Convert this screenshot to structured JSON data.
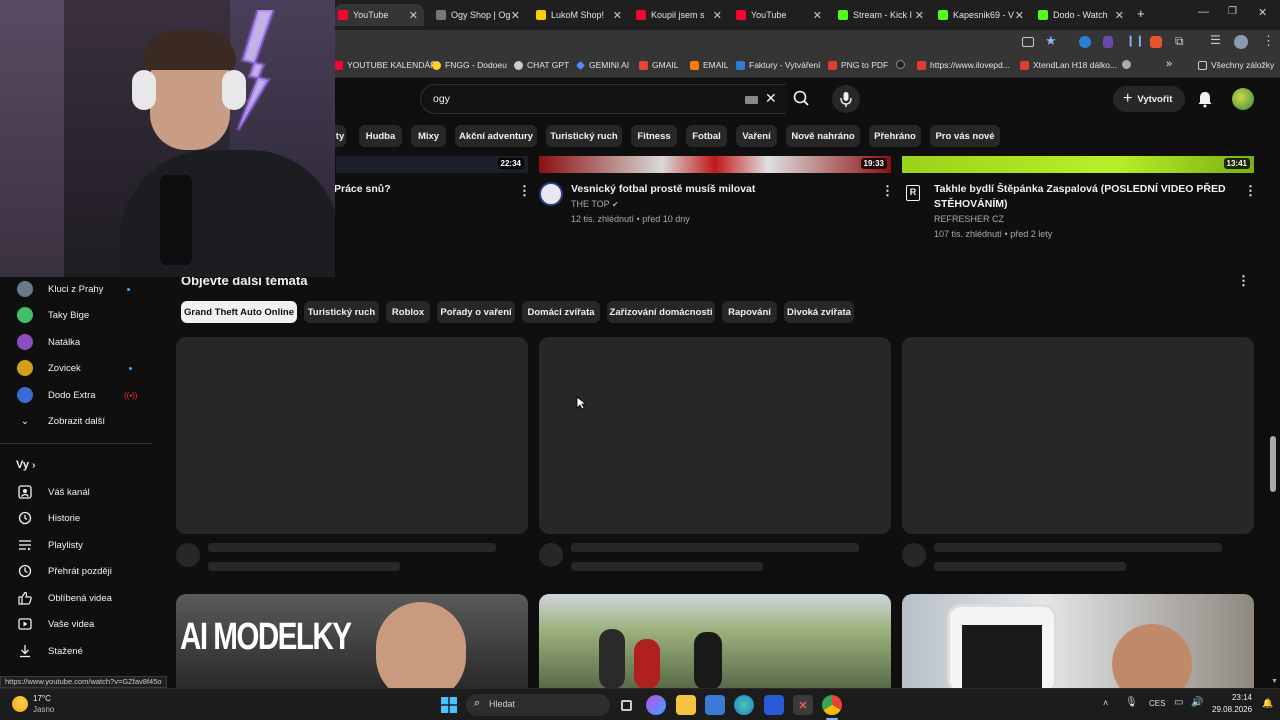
{
  "browser": {
    "tabs": [
      {
        "title": "YouTube",
        "active": true,
        "icon_color": "#ff0033"
      },
      {
        "title": "Ogy Shop | Og",
        "icon_color": "#888888"
      },
      {
        "title": "LukoM Shop!",
        "icon_color": "#f5d000"
      },
      {
        "title": "Koupil jsem s",
        "icon_color": "#ff0033"
      },
      {
        "title": "YouTube",
        "icon_color": "#ff0033"
      },
      {
        "title": "Stream - Kick I",
        "icon_color": "#53fc18"
      },
      {
        "title": "Kapesnik69 - V",
        "icon_color": "#53fc18"
      },
      {
        "title": "Dodo - Watch",
        "icon_color": "#53fc18"
      }
    ],
    "new_tab": "+",
    "bookmarks": [
      {
        "label": "YOUTUBE KALENDÁŘ",
        "color": "#ff0033"
      },
      {
        "label": "FNGG - Dodoeu",
        "color": "#ffcc33"
      },
      {
        "label": "CHAT GPT",
        "color": "#cccccc"
      },
      {
        "label": "GEMINI AI",
        "color": "#4f8cf7"
      },
      {
        "label": "GMAIL",
        "color": "#ea4335"
      },
      {
        "label": "EMAIL",
        "color": "#ff7a00"
      },
      {
        "label": "Faktury - Vytváření",
        "color": "#2d7dd2"
      },
      {
        "label": "PNG to PDF",
        "color": "#e53935"
      },
      {
        "label": "",
        "color": "#222222"
      },
      {
        "label": "https://www.ilovepd...",
        "color": "#e53935"
      },
      {
        "label": "XtendLan H18 dálko...",
        "color": "#e53935"
      },
      {
        "label": "",
        "color": "#aaaaaa"
      }
    ],
    "bookmarks_more": "»",
    "all_bookmarks": "Všechny záložky",
    "status_url": "https://www.youtube.com/watch?v=GZfav8f45o"
  },
  "youtube": {
    "search_value": "ogy",
    "create_label": "Vytvořit",
    "chips": [
      "ty",
      "Hudba",
      "Mixy",
      "Akční adventury",
      "Turistický ruch",
      "Fitness",
      "Fotbal",
      "Vaření",
      "Nově nahráno",
      "Přehráno",
      "Pro vás nové"
    ],
    "top_videos": [
      {
        "title": "Práce snů?",
        "duration": "22:34"
      },
      {
        "title": "Vesnický fotbal prostě musíš milovat",
        "channel": "THE TOP",
        "meta": "12 tis. zhlédnutí • před 10 dny",
        "duration": "19:33"
      },
      {
        "title_line1": "Takhle bydlí Štěpánka Zaspalová (POSLEDNÍ VIDEO PŘED",
        "title_line2": "STĚHOVÁNÍM)",
        "channel": "REFRESHER CZ",
        "meta": "107 tis. zhlédnutí • před 2 lety",
        "duration": "13:41"
      }
    ],
    "explore_heading": "Objevte další témata",
    "explore_chips": [
      "Grand Theft Auto Online",
      "Turistický ruch",
      "Roblox",
      "Pořady o vaření",
      "Domácí zvířata",
      "Zařizování domácnosti",
      "Rapování",
      "Divoká zvířata"
    ],
    "thumb_text": "AI MODELKY"
  },
  "sidebar": {
    "subscriptions": [
      {
        "label": "Kluci z Prahy",
        "color": "#6a7a8a"
      },
      {
        "label": "Taky Bige",
        "color": "#3fbf6a"
      },
      {
        "label": "Natálka",
        "color": "#8a4fbf"
      },
      {
        "label": "Zovicek",
        "color": "#d4a017"
      },
      {
        "label": "Dodo Extra",
        "color": "#3a6ad4"
      }
    ],
    "show_more": "Zobrazit další",
    "you_heading": "Vy",
    "you_items": [
      {
        "label": "Váš kanál",
        "icon": "channel-icon"
      },
      {
        "label": "Historie",
        "icon": "history-icon"
      },
      {
        "label": "Playlisty",
        "icon": "playlists-icon"
      },
      {
        "label": "Přehrát později",
        "icon": "watch-later-icon"
      },
      {
        "label": "Oblíbená videa",
        "icon": "like-icon"
      },
      {
        "label": "Vaše videa",
        "icon": "your-videos-icon"
      },
      {
        "label": "Stažené",
        "icon": "download-icon"
      }
    ]
  },
  "taskbar": {
    "weather_temp": "17°C",
    "weather_desc": "Jasno",
    "search_placeholder": "Hledat",
    "lang": "CES",
    "time": "23:14",
    "date": "29.08.2026"
  }
}
